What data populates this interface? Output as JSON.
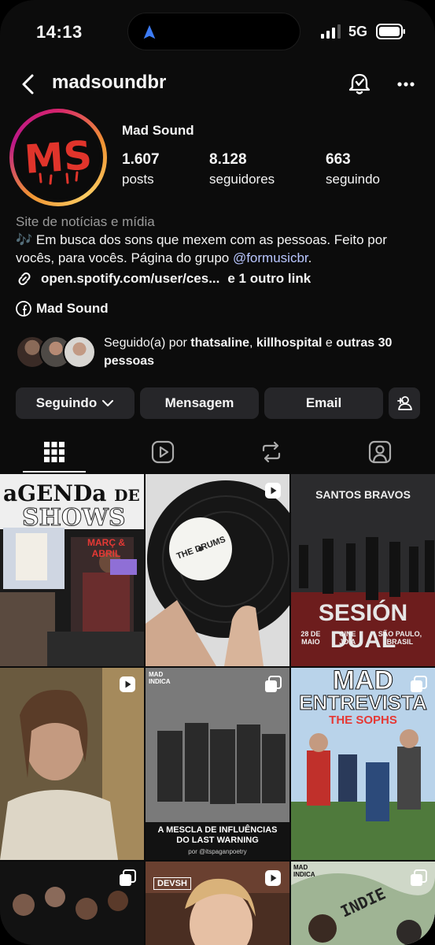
{
  "status": {
    "time": "14:13",
    "network": "5G"
  },
  "header": {
    "username": "madsoundbr"
  },
  "profile": {
    "name": "Mad Sound",
    "avatar_text": "MS",
    "stats": [
      {
        "value": "1.607",
        "label": "posts"
      },
      {
        "value": "8.128",
        "label": "seguidores"
      },
      {
        "value": "663",
        "label": "seguindo"
      }
    ],
    "category": "Site de notícias e mídia",
    "bio_line1": "🎶 Em busca dos sons que mexem com as pessoas. Feito por",
    "bio_line2_pre": "vocês, para vocês. Página do grupo ",
    "bio_mention": "@formusicbr",
    "bio_line2_post": ".",
    "link_text": "open.spotify.com/user/ces...",
    "link_more": "e 1 outro link",
    "facebook": "Mad Sound",
    "followed_prefix": "Seguido(a) por ",
    "followed_user1": "thatsaline",
    "followed_sep": ", ",
    "followed_user2": "killhospital",
    "followed_and": " e ",
    "followed_others": "outras 30 pessoas"
  },
  "buttons": {
    "following": "Seguindo",
    "message": "Mensagem",
    "email": "Email"
  },
  "tabs": [
    "posts-grid",
    "reels",
    "reposts",
    "tagged"
  ],
  "posts": [
    {
      "title_a": "aGENDa",
      "title_b": "DE",
      "title_c": "SHOWS",
      "tag": "MARÇ & ABRIL"
    },
    {
      "label": "THE DRUMS"
    },
    {
      "title": "SANTOS BRAVOS",
      "main": "SESIÓN DUAL",
      "footer1": "28 DE MAIO",
      "footer2": "CINE JOIA",
      "footer3": "SÃO PAULO, BRASIL"
    },
    {
      "label": ""
    },
    {
      "corner": "MAD INDICA",
      "headline": "A MESCLA DE INFLUÊNCIAS DO LAST WARNING",
      "credit": "por @itspaganpoetry"
    },
    {
      "title1": "MAD",
      "title2": "ENTREVISTA",
      "subtitle": "THE SOPHS"
    },
    {
      "label": ""
    },
    {
      "label": "DEVSH"
    },
    {
      "corner": "MAD INDICA",
      "label": "INDIE"
    }
  ],
  "colors": {
    "accent_link": "#b9c6ff",
    "button_bg": "#262629",
    "avatar_red": "#e0342b"
  }
}
